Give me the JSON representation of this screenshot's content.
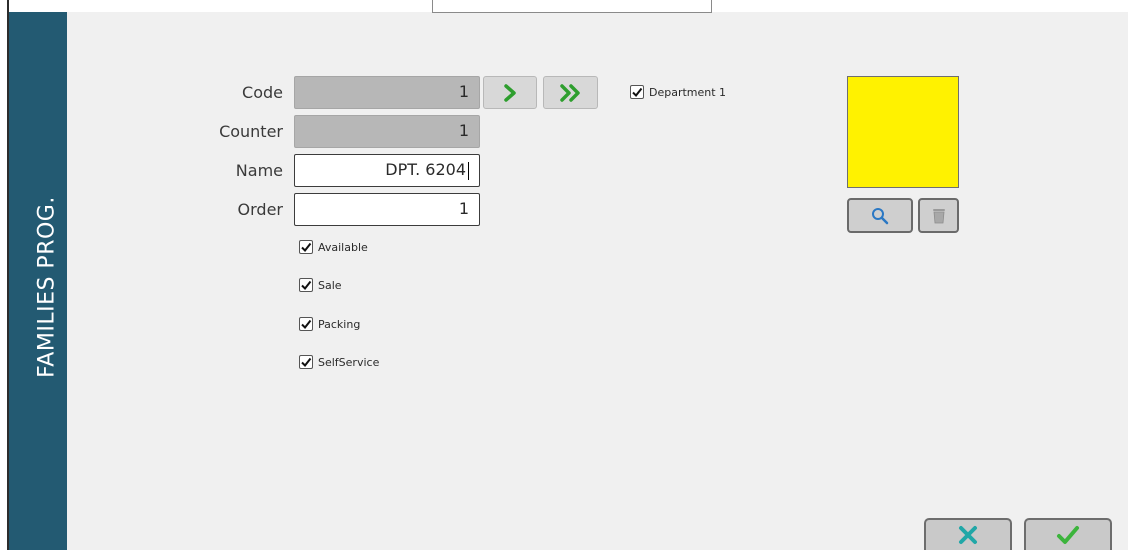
{
  "sidebar": {
    "title": "FAMILIES PROG."
  },
  "form": {
    "code": {
      "label": "Code",
      "value": "1"
    },
    "counter": {
      "label": "Counter",
      "value": "1"
    },
    "name": {
      "label": "Name",
      "value": "DPT. 6204"
    },
    "order": {
      "label": "Order",
      "value": "1"
    }
  },
  "navigation": {
    "next_icon": "chevron-right-icon",
    "last_icon": "double-chevron-right-icon",
    "accent_color": "#2e9e2e"
  },
  "department": {
    "label": "Department 1",
    "checked": true
  },
  "options": [
    {
      "label": "Available",
      "checked": true
    },
    {
      "label": "Sale",
      "checked": true
    },
    {
      "label": "Packing",
      "checked": true
    },
    {
      "label": "SelfService",
      "checked": true
    }
  ],
  "color": {
    "swatch": "#fff200"
  },
  "tools": {
    "search_icon": "magnifier-icon",
    "delete_icon": "trash-icon"
  },
  "actions": {
    "cancel_icon": "x-icon",
    "cancel_color": "#21a7a7",
    "confirm_icon": "check-icon",
    "confirm_color": "#3cb43c"
  }
}
